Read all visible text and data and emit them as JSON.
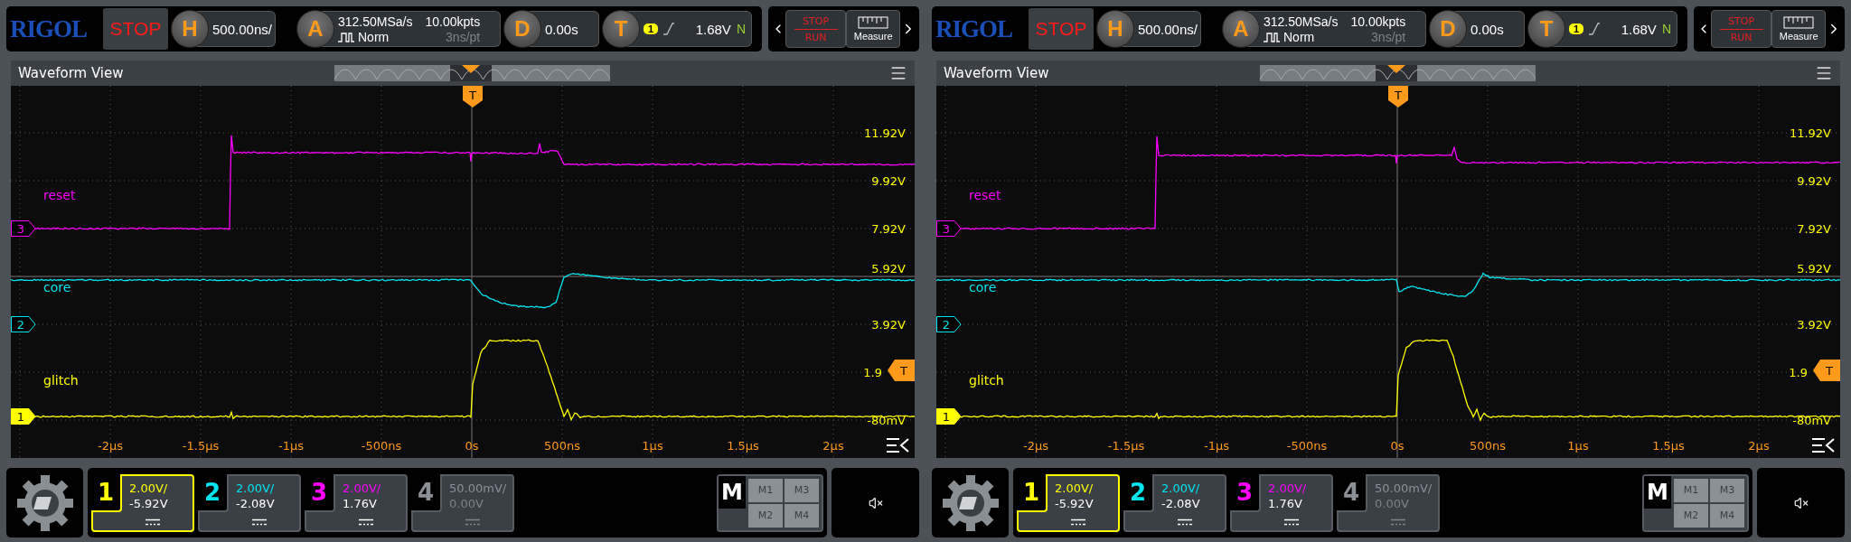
{
  "screens": [
    {
      "top_bar": {
        "logo": "RIGOL",
        "run_state": "STOP",
        "horizontal": {
          "badge": "H",
          "scale": "500.00ns/"
        },
        "acquisition": {
          "badge": "A",
          "sample_rate": "312.50MSa/s",
          "memory_depth": "10.00kpts",
          "mode": "Norm",
          "resolution": "3ns/pt"
        },
        "delay": {
          "badge": "D",
          "value": "0.00s"
        },
        "trigger": {
          "badge": "T",
          "source": "1",
          "level": "1.68V",
          "sweep": "N"
        },
        "run_stop_button": {
          "top": "STOP",
          "bottom": "RUN"
        },
        "measure_button": "Measure"
      },
      "waveform_view": {
        "title": "Waveform View",
        "trigger_marker": "T",
        "trigger_level_marker": "T",
        "y_labels": [
          "11.92V",
          "9.92V",
          "7.92V",
          "5.92V",
          "3.92V",
          "1.9",
          "-80mV"
        ],
        "x_labels": [
          "-2μs",
          "-1.5μs",
          "-1μs",
          "-500ns",
          "0s",
          "500ns",
          "1μs",
          "1.5μs",
          "2μs"
        ],
        "channels": [
          {
            "marker": "3",
            "label": "reset",
            "color": "#ff00ff",
            "selected": false
          },
          {
            "marker": "2",
            "label": "core",
            "color": "#00e5ee",
            "selected": false
          },
          {
            "marker": "1",
            "label": "glitch",
            "color": "#ffff00",
            "selected": true
          }
        ]
      },
      "bottom_bar": {
        "channels": [
          {
            "number": "1",
            "scale": "2.00V/",
            "offset": "-5.92V",
            "color": "#ffff00",
            "selected": true,
            "enabled": true
          },
          {
            "number": "2",
            "scale": "2.00V/",
            "offset": "-2.08V",
            "color": "#00e5ee",
            "selected": false,
            "enabled": true
          },
          {
            "number": "3",
            "scale": "2.00V/",
            "offset": "1.76V",
            "color": "#ff00ff",
            "selected": false,
            "enabled": true
          },
          {
            "number": "4",
            "scale": "50.00mV/",
            "offset": "0.00V",
            "color": "#8a9096",
            "selected": false,
            "enabled": false
          }
        ],
        "math": {
          "label": "M",
          "buttons": [
            "M1",
            "M3",
            "M2",
            "M4"
          ]
        }
      }
    },
    {
      "top_bar": {
        "logo": "RIGOL",
        "run_state": "STOP",
        "horizontal": {
          "badge": "H",
          "scale": "500.00ns/"
        },
        "acquisition": {
          "badge": "A",
          "sample_rate": "312.50MSa/s",
          "memory_depth": "10.00kpts",
          "mode": "Norm",
          "resolution": "3ns/pt"
        },
        "delay": {
          "badge": "D",
          "value": "0.00s"
        },
        "trigger": {
          "badge": "T",
          "source": "1",
          "level": "1.68V",
          "sweep": "N"
        },
        "run_stop_button": {
          "top": "STOP",
          "bottom": "RUN"
        },
        "measure_button": "Measure"
      },
      "waveform_view": {
        "title": "Waveform View",
        "trigger_marker": "T",
        "trigger_level_marker": "T",
        "y_labels": [
          "11.92V",
          "9.92V",
          "7.92V",
          "5.92V",
          "3.92V",
          "1.9",
          "-80mV"
        ],
        "x_labels": [
          "-2μs",
          "-1.5μs",
          "-1μs",
          "-500ns",
          "0s",
          "500ns",
          "1μs",
          "1.5μs",
          "2μs"
        ],
        "channels": [
          {
            "marker": "3",
            "label": "reset",
            "color": "#ff00ff",
            "selected": false
          },
          {
            "marker": "2",
            "label": "core",
            "color": "#00e5ee",
            "selected": false
          },
          {
            "marker": "1",
            "label": "glitch",
            "color": "#ffff00",
            "selected": true
          }
        ]
      },
      "bottom_bar": {
        "channels": [
          {
            "number": "1",
            "scale": "2.00V/",
            "offset": "-5.92V",
            "color": "#ffff00",
            "selected": true,
            "enabled": true
          },
          {
            "number": "2",
            "scale": "2.00V/",
            "offset": "-2.08V",
            "color": "#00e5ee",
            "selected": false,
            "enabled": true
          },
          {
            "number": "3",
            "scale": "2.00V/",
            "offset": "1.76V",
            "color": "#ff00ff",
            "selected": false,
            "enabled": true
          },
          {
            "number": "4",
            "scale": "50.00mV/",
            "offset": "0.00V",
            "color": "#8a9096",
            "selected": false,
            "enabled": false
          }
        ],
        "math": {
          "label": "M",
          "buttons": [
            "M1",
            "M3",
            "M2",
            "M4"
          ]
        }
      }
    }
  ]
}
